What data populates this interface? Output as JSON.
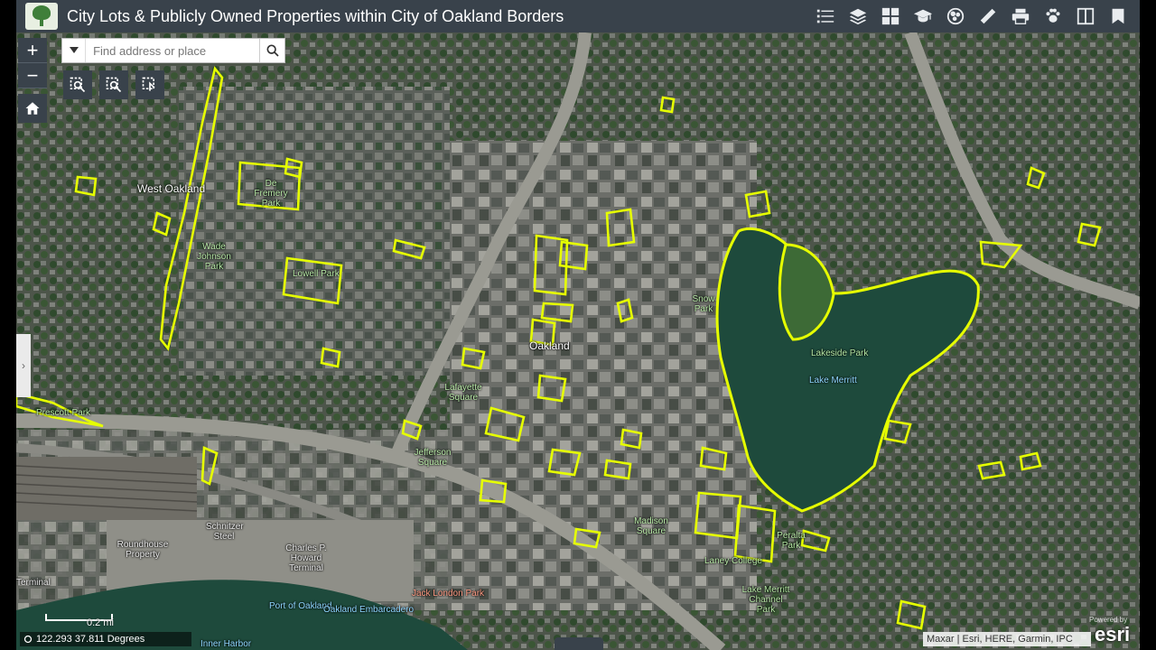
{
  "app": {
    "title": "City Lots & Publicly Owned Properties within City of Oakland Borders"
  },
  "header_tools": [
    "legend-icon",
    "layers-icon",
    "basemap-gallery-icon",
    "education-icon",
    "analysis-icon",
    "measure-icon",
    "print-icon",
    "pets-icon",
    "compare-icon",
    "bookmark-icon"
  ],
  "search": {
    "placeholder": "Find address or place"
  },
  "zoom": {
    "in": "+",
    "out": "−"
  },
  "map_labels": {
    "oakland": "Oakland",
    "west_oakland": "West Oakland",
    "de_fremery": "De Fremery Park",
    "wade_johnson": "Wade Johnson Park",
    "lowell": "Lowell Park",
    "prescott": "Prescott Park",
    "lafayette": "Lafayette Square",
    "jefferson": "Jefferson Square",
    "madison": "Madison Square",
    "laney": "Laney College",
    "lake_merritt_channel": "Lake Merritt Channel Park",
    "peralta": "Peralta Park",
    "lakeside": "Lakeside Park",
    "lake_merritt": "Lake Merritt",
    "snow": "Snow Park",
    "schnitzer": "Schnitzer Steel",
    "roundhouse": "Roundhouse Property",
    "charles_howard": "Charles P. Howard Terminal",
    "jack_london": "Jack London Park",
    "port": "Port of Oakland",
    "terminal": "Terminal",
    "embarcadero": "Oakland Embarcadero",
    "inner_harbor": "Inner Harbor"
  },
  "scale": {
    "label": "0.2 mi"
  },
  "coordinates": {
    "text": "122.293 37.811 Degrees"
  },
  "attribution": {
    "text": "Maxar | Esri, HERE, Garmin, IPC"
  },
  "branding": {
    "esri": "esri",
    "powered": "Powered by"
  },
  "colors": {
    "header": "#39424b",
    "parcel_outline": "#e6ff00",
    "water": "#1e4a3c"
  }
}
